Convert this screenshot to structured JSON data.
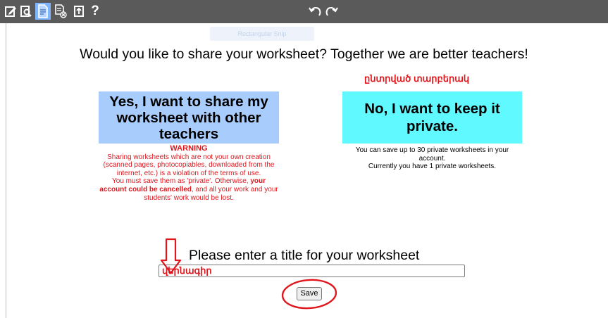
{
  "toolbar": {
    "icons": [
      "edit-icon",
      "preview-icon",
      "save-document-icon",
      "delete-document-icon",
      "export-icon",
      "help-icon",
      "undo-icon",
      "redo-icon"
    ],
    "help_label": "?"
  },
  "ghost_hint": "Rectangular Snip",
  "question": "Would you like to share your worksheet? Together we are better teachers!",
  "selected_label": "ընտրված տարբերակ",
  "share_option": {
    "label": "Yes, I want to share my worksheet with other teachers",
    "color": "#a8ccfc"
  },
  "private_option": {
    "label": "No, I want to keep it private.",
    "color": "#5ff9ff"
  },
  "warning": {
    "title": "WARNING",
    "text1": "Sharing worksheets which are not your own creation (scanned pages, photocopiables, downloaded from the internet, etc.) is a violation of the terms of use.",
    "text2a": "You must save them as 'private'. Otherwise, ",
    "text2b": "your account could be cancelled",
    "text2c": ", and all your work and your students' work would be lost."
  },
  "private_info": {
    "line1": "You can save up to 30 private worksheets in your account.",
    "line2": "Currently you have 1 private worksheets."
  },
  "title_prompt": "Please enter a title for your worksheet",
  "title_input": {
    "value": "վերնագիր"
  },
  "save_label": "Save",
  "colors": {
    "annotation_red": "#e0161d",
    "toolbar": "#5a5a5a",
    "active_tool": "#7db6ff"
  }
}
